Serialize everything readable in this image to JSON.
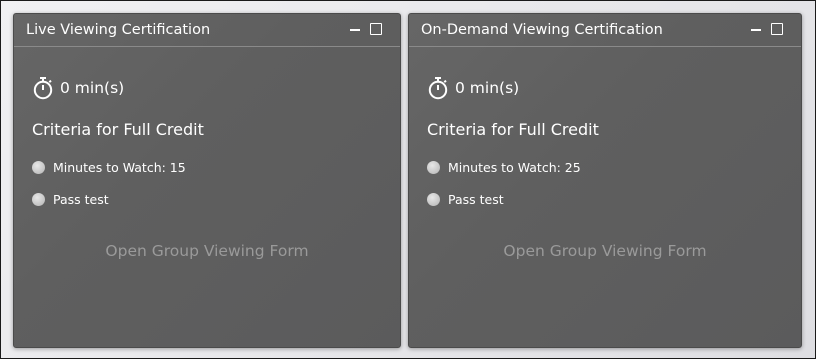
{
  "panels": [
    {
      "title": "Live Viewing Certification",
      "timer": "0 min(s)",
      "criteria_title": "Criteria for Full Credit",
      "criteria": [
        "Minutes to Watch: 15",
        "Pass test"
      ],
      "link": "Open Group Viewing Form"
    },
    {
      "title": "On-Demand Viewing Certification",
      "timer": "0 min(s)",
      "criteria_title": "Criteria for Full Credit",
      "criteria": [
        "Minutes to Watch: 25",
        "Pass test"
      ],
      "link": "Open Group Viewing Form"
    }
  ],
  "icons": {
    "minimize": "minimize-icon",
    "maximize": "maximize-icon",
    "timer": "stopwatch-icon",
    "criterion": "radio-dot-icon"
  },
  "colors": {
    "panel_bg": "#606060",
    "text": "#ffffff",
    "link": "#9a9a9a",
    "divider": "#8a8a8a"
  }
}
